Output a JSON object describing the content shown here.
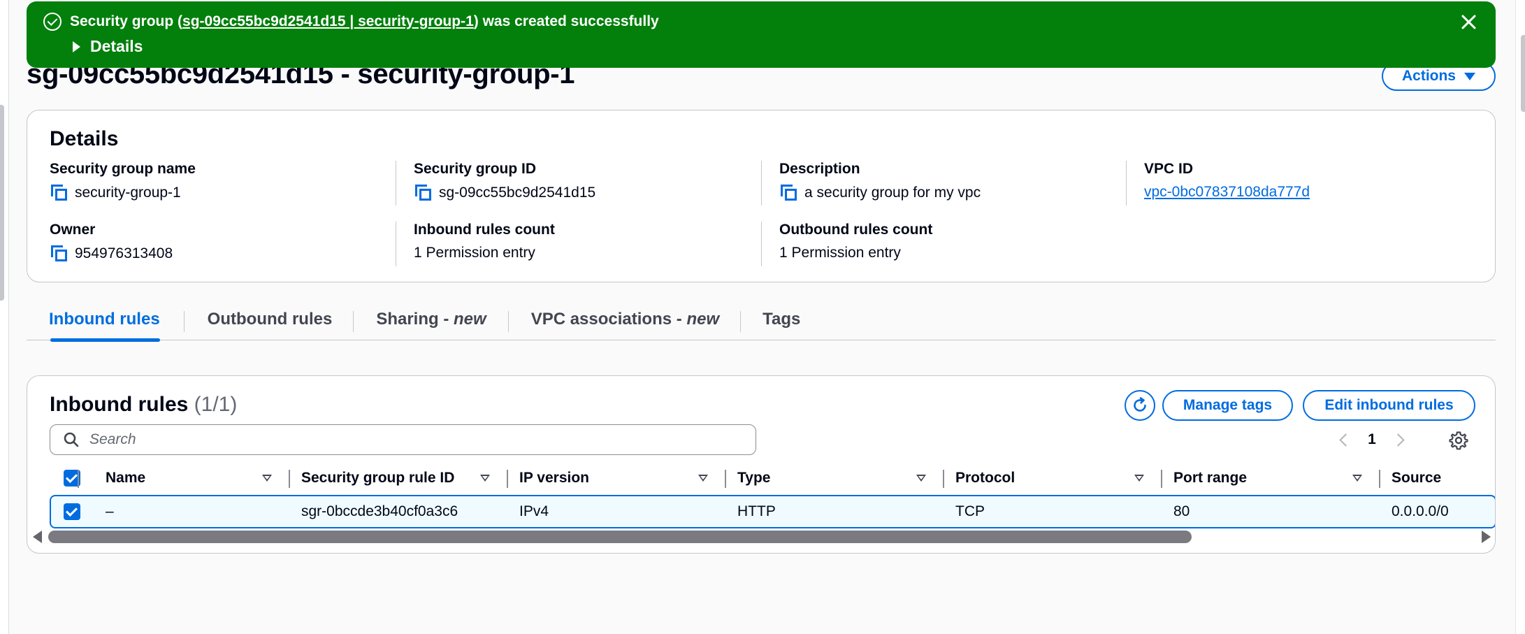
{
  "flash": {
    "prefix": "Security group (",
    "link": "sg-09cc55bc9d2541d15 | security-group-1",
    "suffix": ") was created successfully",
    "details_label": "Details",
    "color": "#037f0c"
  },
  "page": {
    "title": "sg-09cc55bc9d2541d15 - security-group-1",
    "actions_label": "Actions"
  },
  "details": {
    "title": "Details",
    "fields": {
      "sg_name": {
        "label": "Security group name",
        "value": "security-group-1"
      },
      "sg_id": {
        "label": "Security group ID",
        "value": "sg-09cc55bc9d2541d15"
      },
      "description": {
        "label": "Description",
        "value": "a security group for my vpc"
      },
      "vpc_id": {
        "label": "VPC ID",
        "value": "vpc-0bc07837108da777d"
      },
      "owner": {
        "label": "Owner",
        "value": "954976313408"
      },
      "inbound_count": {
        "label": "Inbound rules count",
        "value": "1 Permission entry"
      },
      "outbound_count": {
        "label": "Outbound rules count",
        "value": "1 Permission entry"
      }
    }
  },
  "tabs": [
    {
      "label": "Inbound rules",
      "suffix": ""
    },
    {
      "label": "Outbound rules",
      "suffix": ""
    },
    {
      "label": "Sharing - ",
      "suffix": "new"
    },
    {
      "label": "VPC associations - ",
      "suffix": "new"
    },
    {
      "label": "Tags",
      "suffix": ""
    }
  ],
  "inbound": {
    "title": "Inbound rules",
    "count": "(1/1)",
    "manage_tags_label": "Manage tags",
    "edit_label": "Edit inbound rules",
    "search_placeholder": "Search",
    "page": "1",
    "columns": [
      "Name",
      "Security group rule ID",
      "IP version",
      "Type",
      "Protocol",
      "Port range",
      "Source"
    ],
    "rows": [
      {
        "name": "–",
        "rule_id": "sgr-0bccde3b40cf0a3c6",
        "ip_version": "IPv4",
        "type": "HTTP",
        "protocol": "TCP",
        "port_range": "80",
        "source": "0.0.0.0/0",
        "selected": true
      }
    ]
  },
  "colors": {
    "accent": "#006ce0",
    "success": "#037f0c",
    "text": "#000716"
  },
  "icons": [
    "status-positive-icon",
    "caret-right-icon",
    "close-icon",
    "caret-down-icon",
    "copy-icon",
    "refresh-icon",
    "search-icon",
    "angle-left-icon",
    "angle-right-icon",
    "settings-icon",
    "check-icon"
  ]
}
